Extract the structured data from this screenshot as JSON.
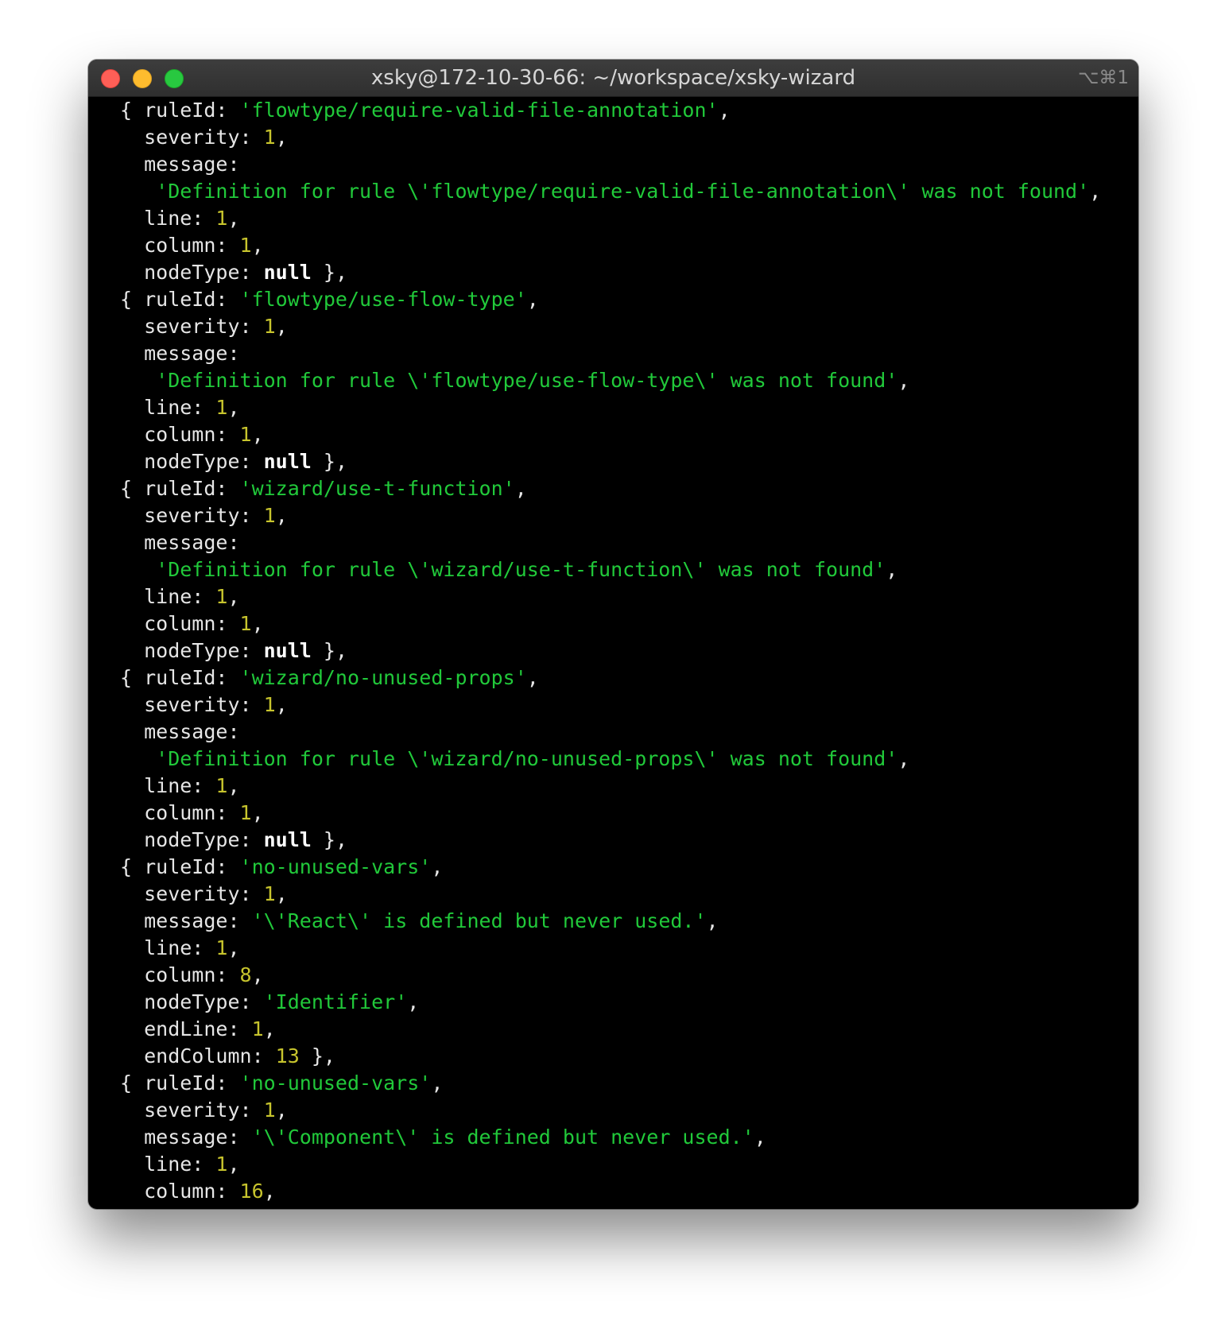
{
  "window": {
    "title": "xsky@172-10-30-66: ~/workspace/xsky-wizard",
    "shortcut": "⌥⌘1"
  },
  "terminal": {
    "lines": [
      [
        {
          "t": "p",
          "v": "{ ruleId: "
        },
        {
          "t": "s",
          "v": "'flowtype/require-valid-file-annotation'"
        },
        {
          "t": "p",
          "v": ","
        }
      ],
      [
        {
          "t": "p",
          "v": "  severity: "
        },
        {
          "t": "n",
          "v": "1"
        },
        {
          "t": "p",
          "v": ","
        }
      ],
      [
        {
          "t": "p",
          "v": "  message:"
        }
      ],
      [
        {
          "t": "p",
          "v": "   "
        },
        {
          "t": "s",
          "v": "'Definition for rule \\'flowtype/require-valid-file-annotation\\' was not found'"
        },
        {
          "t": "p",
          "v": ","
        }
      ],
      [
        {
          "t": "p",
          "v": "  line: "
        },
        {
          "t": "n",
          "v": "1"
        },
        {
          "t": "p",
          "v": ","
        }
      ],
      [
        {
          "t": "p",
          "v": "  column: "
        },
        {
          "t": "n",
          "v": "1"
        },
        {
          "t": "p",
          "v": ","
        }
      ],
      [
        {
          "t": "p",
          "v": "  nodeType: "
        },
        {
          "t": "k",
          "v": "null"
        },
        {
          "t": "p",
          "v": " },"
        }
      ],
      [
        {
          "t": "p",
          "v": "{ ruleId: "
        },
        {
          "t": "s",
          "v": "'flowtype/use-flow-type'"
        },
        {
          "t": "p",
          "v": ","
        }
      ],
      [
        {
          "t": "p",
          "v": "  severity: "
        },
        {
          "t": "n",
          "v": "1"
        },
        {
          "t": "p",
          "v": ","
        }
      ],
      [
        {
          "t": "p",
          "v": "  message:"
        }
      ],
      [
        {
          "t": "p",
          "v": "   "
        },
        {
          "t": "s",
          "v": "'Definition for rule \\'flowtype/use-flow-type\\' was not found'"
        },
        {
          "t": "p",
          "v": ","
        }
      ],
      [
        {
          "t": "p",
          "v": "  line: "
        },
        {
          "t": "n",
          "v": "1"
        },
        {
          "t": "p",
          "v": ","
        }
      ],
      [
        {
          "t": "p",
          "v": "  column: "
        },
        {
          "t": "n",
          "v": "1"
        },
        {
          "t": "p",
          "v": ","
        }
      ],
      [
        {
          "t": "p",
          "v": "  nodeType: "
        },
        {
          "t": "k",
          "v": "null"
        },
        {
          "t": "p",
          "v": " },"
        }
      ],
      [
        {
          "t": "p",
          "v": "{ ruleId: "
        },
        {
          "t": "s",
          "v": "'wizard/use-t-function'"
        },
        {
          "t": "p",
          "v": ","
        }
      ],
      [
        {
          "t": "p",
          "v": "  severity: "
        },
        {
          "t": "n",
          "v": "1"
        },
        {
          "t": "p",
          "v": ","
        }
      ],
      [
        {
          "t": "p",
          "v": "  message:"
        }
      ],
      [
        {
          "t": "p",
          "v": "   "
        },
        {
          "t": "s",
          "v": "'Definition for rule \\'wizard/use-t-function\\' was not found'"
        },
        {
          "t": "p",
          "v": ","
        }
      ],
      [
        {
          "t": "p",
          "v": "  line: "
        },
        {
          "t": "n",
          "v": "1"
        },
        {
          "t": "p",
          "v": ","
        }
      ],
      [
        {
          "t": "p",
          "v": "  column: "
        },
        {
          "t": "n",
          "v": "1"
        },
        {
          "t": "p",
          "v": ","
        }
      ],
      [
        {
          "t": "p",
          "v": "  nodeType: "
        },
        {
          "t": "k",
          "v": "null"
        },
        {
          "t": "p",
          "v": " },"
        }
      ],
      [
        {
          "t": "p",
          "v": "{ ruleId: "
        },
        {
          "t": "s",
          "v": "'wizard/no-unused-props'"
        },
        {
          "t": "p",
          "v": ","
        }
      ],
      [
        {
          "t": "p",
          "v": "  severity: "
        },
        {
          "t": "n",
          "v": "1"
        },
        {
          "t": "p",
          "v": ","
        }
      ],
      [
        {
          "t": "p",
          "v": "  message:"
        }
      ],
      [
        {
          "t": "p",
          "v": "   "
        },
        {
          "t": "s",
          "v": "'Definition for rule \\'wizard/no-unused-props\\' was not found'"
        },
        {
          "t": "p",
          "v": ","
        }
      ],
      [
        {
          "t": "p",
          "v": "  line: "
        },
        {
          "t": "n",
          "v": "1"
        },
        {
          "t": "p",
          "v": ","
        }
      ],
      [
        {
          "t": "p",
          "v": "  column: "
        },
        {
          "t": "n",
          "v": "1"
        },
        {
          "t": "p",
          "v": ","
        }
      ],
      [
        {
          "t": "p",
          "v": "  nodeType: "
        },
        {
          "t": "k",
          "v": "null"
        },
        {
          "t": "p",
          "v": " },"
        }
      ],
      [
        {
          "t": "p",
          "v": "{ ruleId: "
        },
        {
          "t": "s",
          "v": "'no-unused-vars'"
        },
        {
          "t": "p",
          "v": ","
        }
      ],
      [
        {
          "t": "p",
          "v": "  severity: "
        },
        {
          "t": "n",
          "v": "1"
        },
        {
          "t": "p",
          "v": ","
        }
      ],
      [
        {
          "t": "p",
          "v": "  message: "
        },
        {
          "t": "s",
          "v": "'\\'React\\' is defined but never used.'"
        },
        {
          "t": "p",
          "v": ","
        }
      ],
      [
        {
          "t": "p",
          "v": "  line: "
        },
        {
          "t": "n",
          "v": "1"
        },
        {
          "t": "p",
          "v": ","
        }
      ],
      [
        {
          "t": "p",
          "v": "  column: "
        },
        {
          "t": "n",
          "v": "8"
        },
        {
          "t": "p",
          "v": ","
        }
      ],
      [
        {
          "t": "p",
          "v": "  nodeType: "
        },
        {
          "t": "s",
          "v": "'Identifier'"
        },
        {
          "t": "p",
          "v": ","
        }
      ],
      [
        {
          "t": "p",
          "v": "  endLine: "
        },
        {
          "t": "n",
          "v": "1"
        },
        {
          "t": "p",
          "v": ","
        }
      ],
      [
        {
          "t": "p",
          "v": "  endColumn: "
        },
        {
          "t": "n",
          "v": "13"
        },
        {
          "t": "p",
          "v": " },"
        }
      ],
      [
        {
          "t": "p",
          "v": "{ ruleId: "
        },
        {
          "t": "s",
          "v": "'no-unused-vars'"
        },
        {
          "t": "p",
          "v": ","
        }
      ],
      [
        {
          "t": "p",
          "v": "  severity: "
        },
        {
          "t": "n",
          "v": "1"
        },
        {
          "t": "p",
          "v": ","
        }
      ],
      [
        {
          "t": "p",
          "v": "  message: "
        },
        {
          "t": "s",
          "v": "'\\'Component\\' is defined but never used.'"
        },
        {
          "t": "p",
          "v": ","
        }
      ],
      [
        {
          "t": "p",
          "v": "  line: "
        },
        {
          "t": "n",
          "v": "1"
        },
        {
          "t": "p",
          "v": ","
        }
      ],
      [
        {
          "t": "p",
          "v": "  column: "
        },
        {
          "t": "n",
          "v": "16"
        },
        {
          "t": "p",
          "v": ","
        }
      ]
    ]
  },
  "colors": {
    "background": "#000000",
    "plain": "#e6e6e6",
    "string": "#21c93a",
    "number": "#c7c42d",
    "keyword": "#ffffff",
    "close": "#fe5f57",
    "minimize": "#febc2e",
    "zoom": "#28c840"
  }
}
